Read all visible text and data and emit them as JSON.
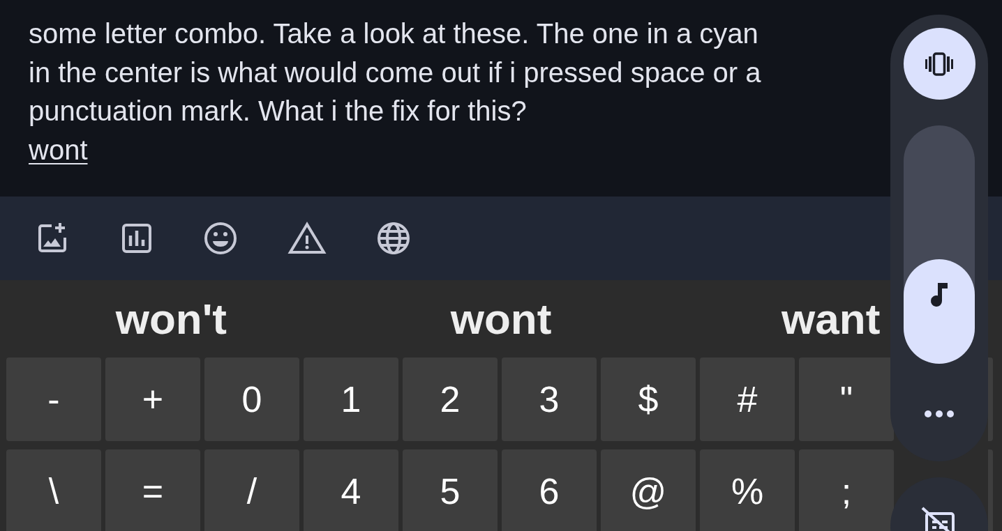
{
  "message": {
    "lines": [
      "some letter combo. Take a look at these. The one in a cyan",
      "in the center is what would come out if i pressed space or a",
      "punctuation mark. What i the fix for this?"
    ],
    "composing": "wont"
  },
  "suggestions": [
    "won't",
    "wont",
    "want"
  ],
  "keys": [
    [
      "-",
      "+",
      "0",
      "1",
      "2",
      "3",
      "$",
      "#",
      "\""
    ],
    [
      "\\",
      "=",
      "/",
      "4",
      "5",
      "6",
      "@",
      "%",
      ";"
    ]
  ],
  "volume_panel": {
    "level": 0.44
  }
}
